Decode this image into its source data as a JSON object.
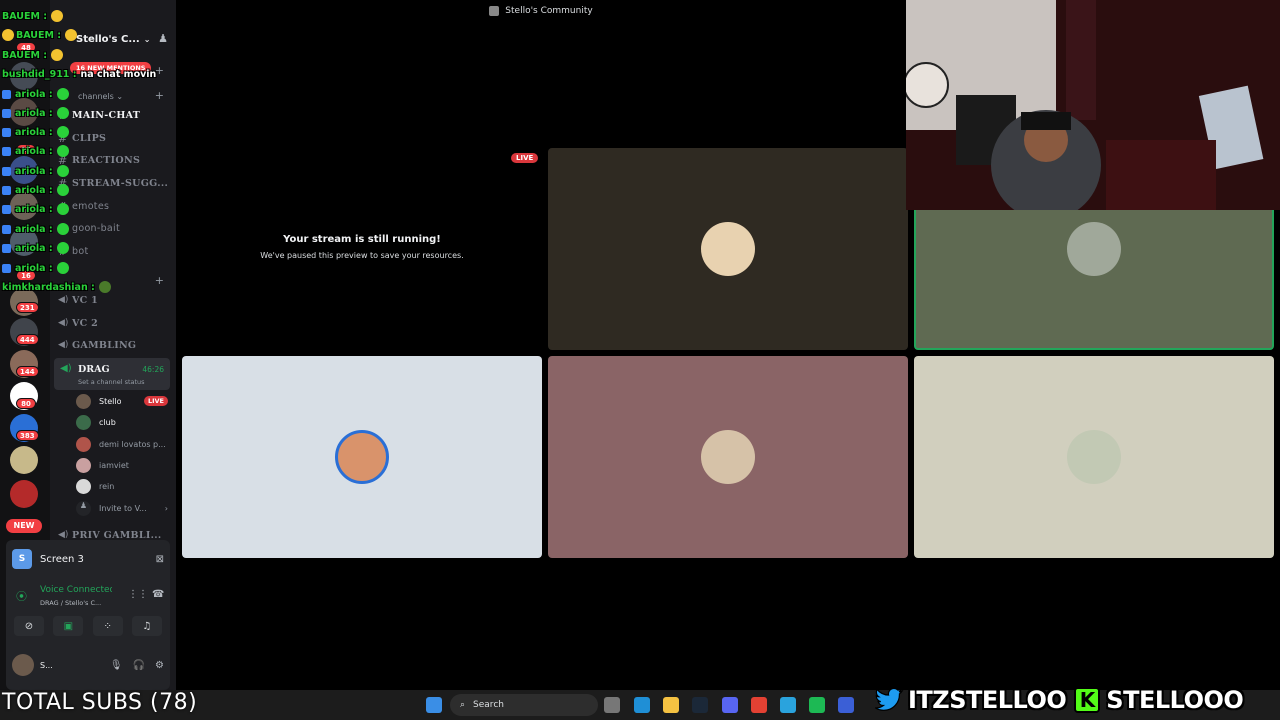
{
  "window": {
    "title": "Stello's Community"
  },
  "server": {
    "name": "Stello's C...",
    "mentions": "16 NEW MENTIONS"
  },
  "categories": [
    {
      "label": "channels"
    }
  ],
  "text_channels": [
    "MAIN-CHAT",
    "CLIPS",
    "REACTIONS",
    "STREAM-SUGG...",
    "emotes",
    "goon-bait",
    "bot"
  ],
  "voice_channels": [
    "VC 1",
    "VC 2",
    "GAMBLING"
  ],
  "drag": {
    "name": "DRAG",
    "time": "46:26",
    "status": "Set a channel status"
  },
  "voice_users": [
    {
      "name": "Stello",
      "live": "LIVE",
      "color": "#6b5a4c"
    },
    {
      "name": "club",
      "color": "#3b6b4a"
    },
    {
      "name": "demi lovatos p...",
      "color": "#b0544a"
    },
    {
      "name": "iamviet",
      "color": "#c9a0a0"
    },
    {
      "name": "rein",
      "color": "#d9d9d9"
    },
    {
      "name": "Invite to V...",
      "color": "#232428"
    }
  ],
  "priv": {
    "name": "PRIV GAMBLI..."
  },
  "rail": {
    "badges": [
      "48",
      "15",
      "16",
      "231",
      "444",
      "144",
      "80",
      "383"
    ],
    "new_label": "NEW"
  },
  "panel": {
    "screen_label": "Screen 3",
    "screen_icon": "S",
    "voice_title": "Voice Connected",
    "voice_sub": "DRAG / Stello's C...",
    "user_name": "S..."
  },
  "stage": {
    "paused_title": "Your stream is still running!",
    "paused_sub": "We've paused this preview to save your resources.",
    "live": "LIVE"
  },
  "chat": [
    {
      "user": "BAUEM",
      "msg": ""
    },
    {
      "user": "BAUEM",
      "msg": ""
    },
    {
      "user": "BAUEM",
      "msg": ""
    },
    {
      "user": "bushdid_911",
      "msg": "na chat movin"
    },
    {
      "user": "ariola",
      "msg": ""
    },
    {
      "user": "ariola",
      "msg": ""
    },
    {
      "user": "ariola",
      "msg": ""
    },
    {
      "user": "ariola",
      "msg": ""
    },
    {
      "user": "ariola",
      "msg": ""
    },
    {
      "user": "ariola",
      "msg": ""
    },
    {
      "user": "ariola",
      "msg": ""
    },
    {
      "user": "ariola",
      "msg": ""
    },
    {
      "user": "ariola",
      "msg": ""
    },
    {
      "user": "ariola",
      "msg": ""
    },
    {
      "user": "kimkhardashian",
      "msg": ""
    }
  ],
  "taskbar": {
    "search": "Search"
  },
  "overlay": {
    "subs": "TOTAL SUBS (78)",
    "twitter": "ITZSTELLOO",
    "kick_letter": "K",
    "kick": "STELLOOO"
  },
  "tiles": [
    {
      "bg": "#2f2a22",
      "av": "#e8d2b0"
    },
    {
      "bg": "#5f6a52",
      "av": "#a0a89a"
    },
    {
      "bg": "#d8dfe6",
      "av": "#d9936b"
    },
    {
      "bg": "#8a6466",
      "av": "#d6c2a8"
    },
    {
      "bg": "#d1cfbe",
      "av": "#c2c9b4"
    }
  ]
}
